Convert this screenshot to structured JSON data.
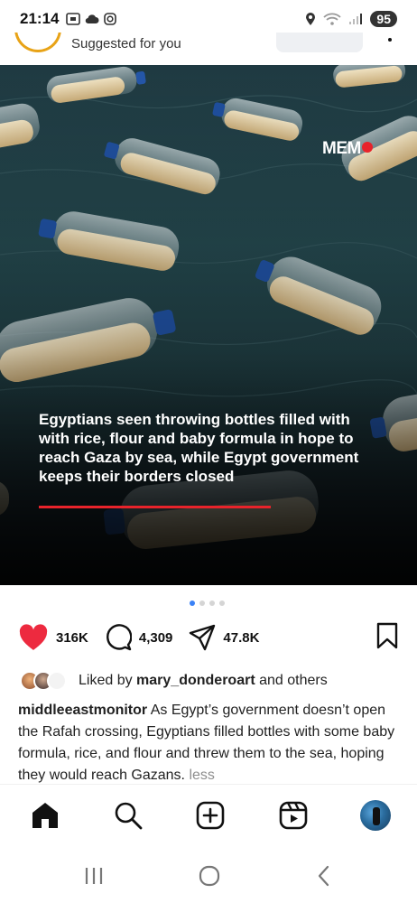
{
  "status_bar": {
    "time": "21:14",
    "battery": "95"
  },
  "post": {
    "header": {
      "subtitle": "Suggested for you"
    },
    "image": {
      "watermark": "MEM",
      "overlay_text": "Egyptians seen throwing bottles filled with with rice, flour and baby formula in hope to reach Gaza by sea, while Egypt government keeps their borders closed"
    },
    "carousel": {
      "total": 4,
      "active_index": 0
    },
    "actions": {
      "likes": "316K",
      "comments": "4,309",
      "shares": "47.8K"
    },
    "liked_by": {
      "prefix": "Liked by ",
      "user": "mary_donderoart",
      "suffix": " and others"
    },
    "caption": {
      "username": "middleeastmonitor",
      "text": " As Egypt’s government doesn’t open the Rafah crossing, Egyptians filled bottles with some baby formula, rice, and flour and threw them to the sea, hoping they would reach Gazans. ",
      "less": "less"
    }
  },
  "colors": {
    "like_red": "#ed2a3f",
    "accent_red": "#e8232b",
    "pager_active": "#3b82f6"
  },
  "icons": {
    "bottom_nav": [
      "home-icon",
      "search-icon",
      "create-icon",
      "reels-icon",
      "profile-avatar"
    ],
    "system_nav": [
      "recents-icon",
      "home-circle-icon",
      "back-icon"
    ]
  }
}
